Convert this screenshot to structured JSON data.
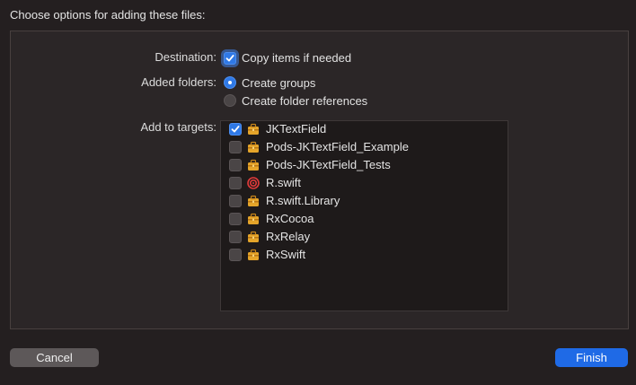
{
  "dialog": {
    "title": "Choose options for adding these files:"
  },
  "destination": {
    "label": "Destination:",
    "option_label": "Copy items if needed",
    "checked": true
  },
  "added_folders": {
    "label": "Added folders:",
    "options": [
      {
        "label": "Create groups",
        "selected": true
      },
      {
        "label": "Create folder references",
        "selected": false
      }
    ]
  },
  "targets": {
    "label": "Add to targets:",
    "items": [
      {
        "name": "JKTextField",
        "checked": true,
        "icon": "toolbox-icon"
      },
      {
        "name": "Pods-JKTextField_Example",
        "checked": false,
        "icon": "toolbox-icon"
      },
      {
        "name": "Pods-JKTextField_Tests",
        "checked": false,
        "icon": "toolbox-icon"
      },
      {
        "name": "R.swift",
        "checked": false,
        "icon": "target-icon"
      },
      {
        "name": "R.swift.Library",
        "checked": false,
        "icon": "toolbox-icon"
      },
      {
        "name": "RxCocoa",
        "checked": false,
        "icon": "toolbox-icon"
      },
      {
        "name": "RxRelay",
        "checked": false,
        "icon": "toolbox-icon"
      },
      {
        "name": "RxSwift",
        "checked": false,
        "icon": "toolbox-icon"
      }
    ]
  },
  "buttons": {
    "cancel": "Cancel",
    "finish": "Finish"
  },
  "colors": {
    "accent": "#2f79e6",
    "background": "#241f20",
    "panel": "#2b2627"
  }
}
